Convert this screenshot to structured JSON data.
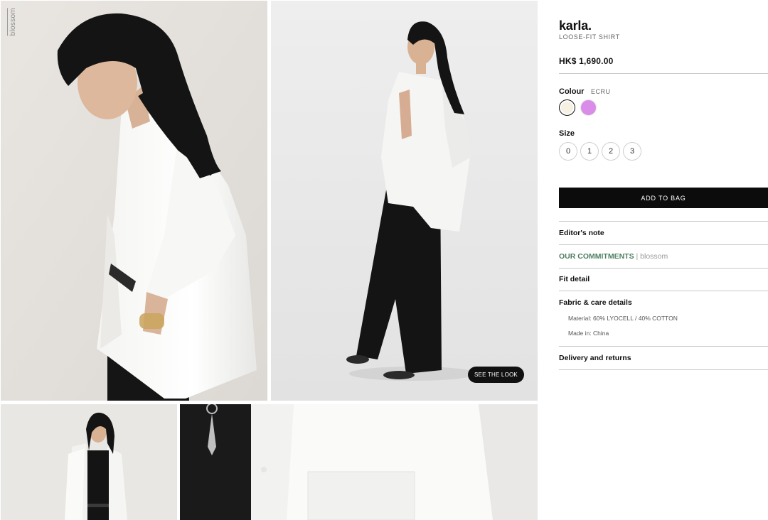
{
  "gallery": {
    "watermark": "blossom",
    "see_the_look_label": "SEE THE LOOK"
  },
  "product": {
    "brand": "karla.",
    "name": "LOOSE-FIT SHIRT",
    "price": "HK$ 1,690.00"
  },
  "colour": {
    "label": "Colour",
    "selected": "ECRU",
    "swatches": [
      {
        "name": "ECRU",
        "hex": "#f6f0e2"
      },
      {
        "name": "lilac",
        "hex": "#d98ce8"
      }
    ]
  },
  "size": {
    "label": "Size",
    "options": [
      "0",
      "1",
      "2",
      "3"
    ]
  },
  "add_to_bag_label": "ADD TO BAG",
  "accordion": {
    "editors_note": "Editor's note",
    "commitments_main": "OUR COMMITMENTS",
    "commitments_separator": "|",
    "commitments_brand": "blossom",
    "fit_detail": "Fit detail",
    "fabric_care": "Fabric & care details",
    "material": "Material: 60% LYOCELL / 40% COTTON",
    "made_in": "Made in: China",
    "delivery_returns": "Delivery and returns"
  },
  "colors": {
    "accent_green": "#4f7f63",
    "button_black": "#0c0c0c"
  }
}
